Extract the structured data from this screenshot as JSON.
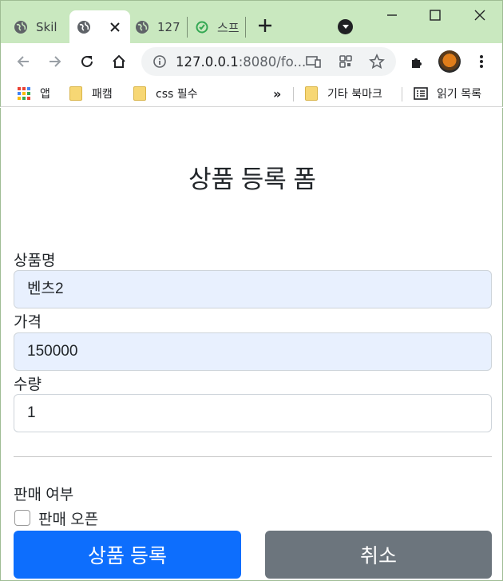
{
  "browser": {
    "tabs": [
      {
        "label": "Skil"
      },
      {
        "label": ""
      },
      {
        "label": "127"
      },
      {
        "label": "스프"
      }
    ],
    "address": {
      "host": "127.0.0.1",
      "rest": ":8080/fo..."
    },
    "bookmarks": {
      "apps": "앱",
      "b1": "패캠",
      "b2": "css 필수",
      "more": "»",
      "other": "기타 북마크",
      "reading": "읽기 목록"
    }
  },
  "form": {
    "title": "상품 등록 폼",
    "name_label": "상품명",
    "name_value": "벤츠2",
    "price_label": "가격",
    "price_value": "150000",
    "qty_label": "수량",
    "qty_value": "1",
    "sale_label": "판매 여부",
    "open_label": "판매 오픈",
    "open_checked": false,
    "submit_label": "상품 등록",
    "cancel_label": "취소"
  },
  "colors": {
    "primary": "#0d6efd",
    "secondary": "#6c757d",
    "autofill": "#e8f0fe",
    "titlebar": "#c9e8bf"
  }
}
